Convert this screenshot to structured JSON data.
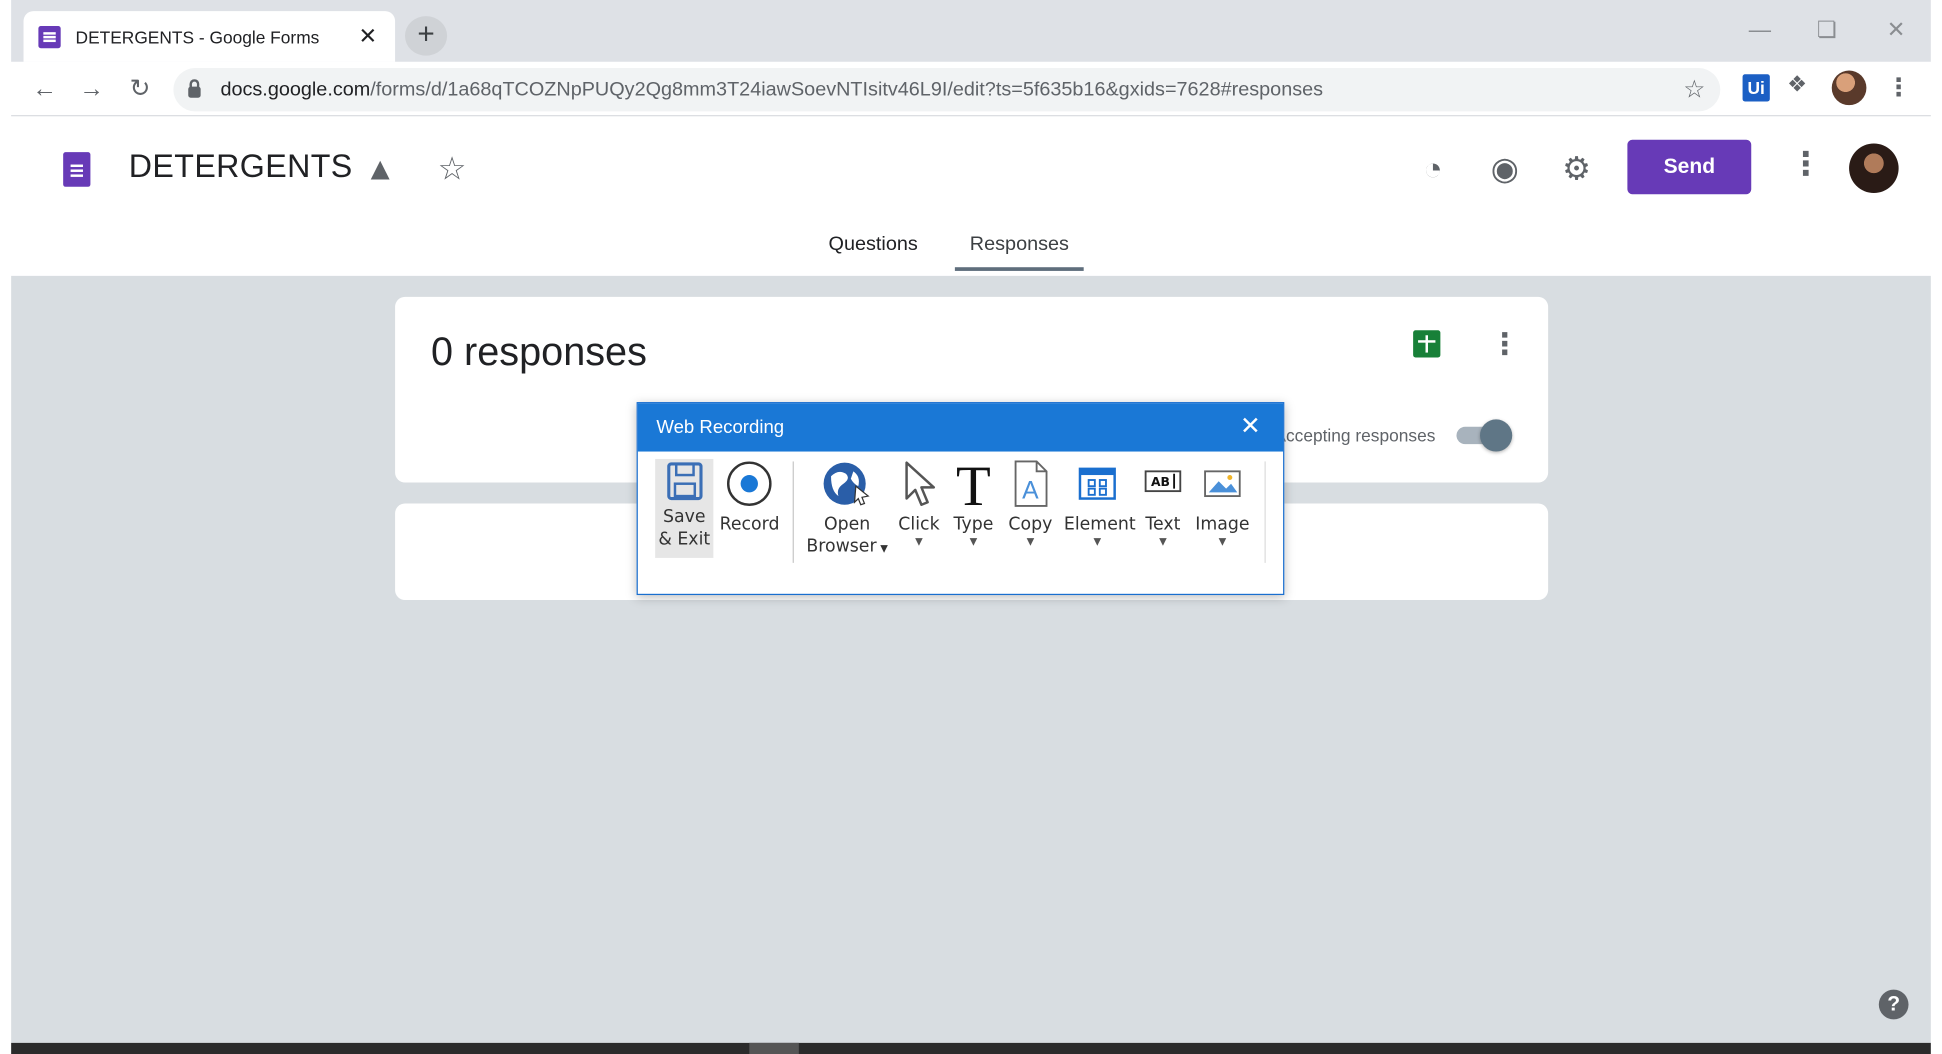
{
  "browser": {
    "tab_title": "DETERGENTS - Google Forms",
    "tab_close": "✕",
    "new_tab": "+",
    "url_host": "docs.google.com",
    "url_path": "/forms/d/1a68qTCOZNpPUQy2Qg8mm3T24iawSoevNTIsitv46L9I/edit?ts=5f635b16&gxids=7628#responses",
    "extension_label": "Ui"
  },
  "forms": {
    "title": "DETERGENTS",
    "send_label": "Send",
    "tabs": [
      {
        "label": "Questions",
        "active": false
      },
      {
        "label": "Responses",
        "active": true
      }
    ],
    "accent_color": "#673ab7"
  },
  "responses": {
    "count_label": "0 responses",
    "accepting_label": "Accepting responses",
    "accepting": true
  },
  "web_recording": {
    "title": "Web Recording",
    "buttons": [
      {
        "label_line1": "Save",
        "label_line2": "& Exit",
        "icon": "floppy-disk-icon"
      },
      {
        "label_line1": "Record",
        "icon": "record-icon"
      },
      {
        "label_line1": "Open",
        "label_line2": "Browser",
        "icon": "globe-icon",
        "dropdown": true
      },
      {
        "label_line1": "Click",
        "icon": "cursor-icon",
        "dropdown": true
      },
      {
        "label_line1": "Type",
        "icon": "type-icon",
        "dropdown": true
      },
      {
        "label_line1": "Copy",
        "icon": "copy-icon",
        "dropdown": true
      },
      {
        "label_line1": "Element",
        "icon": "element-icon",
        "dropdown": true
      },
      {
        "label_line1": "Text",
        "icon": "text-icon",
        "dropdown": true
      },
      {
        "label_line1": "Image",
        "icon": "image-icon",
        "dropdown": true
      }
    ],
    "title_bar_color": "#1a78d6"
  },
  "help_label": "?"
}
